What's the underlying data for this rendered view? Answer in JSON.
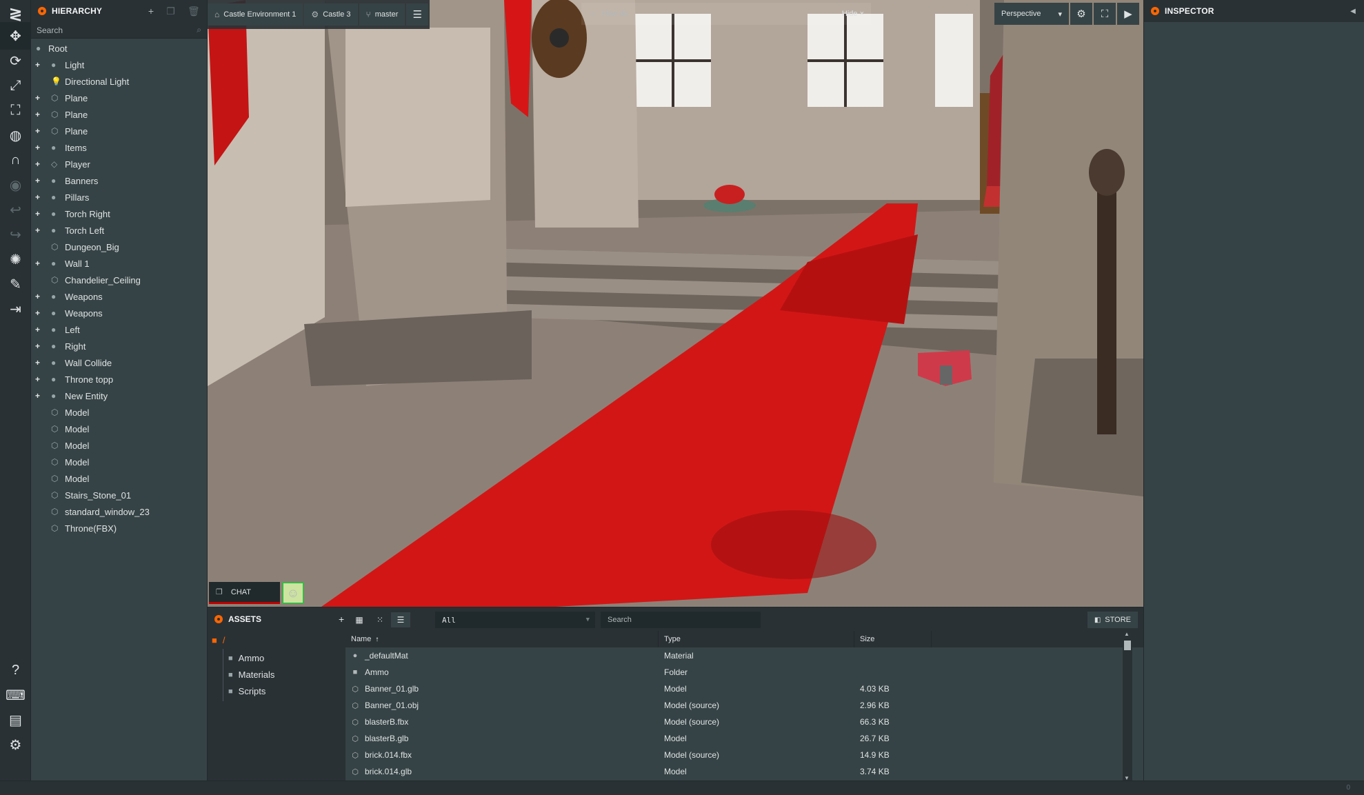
{
  "toolbar": {
    "items": [
      "logo-icon",
      "translate-icon",
      "rotate-icon",
      "scale-icon",
      "resize-icon",
      "world-icon",
      "snap-icon",
      "visibility-icon",
      "undo-icon",
      "redo-icon",
      "light-icon",
      "edit-icon",
      "publish-icon"
    ],
    "bottom": [
      "help-icon",
      "keyboard-icon",
      "feedback-icon",
      "settings-icon"
    ]
  },
  "hierarchy": {
    "title": "HIERARCHY",
    "search_placeholder": "Search",
    "root": "Root",
    "nodes": [
      {
        "label": "Light",
        "expandable": true,
        "icon": "entity-icon"
      },
      {
        "label": "Directional Light",
        "expandable": false,
        "icon": "light-bulb-icon"
      },
      {
        "label": "Plane",
        "expandable": true,
        "icon": "model-icon"
      },
      {
        "label": "Plane",
        "expandable": true,
        "icon": "model-icon"
      },
      {
        "label": "Plane",
        "expandable": true,
        "icon": "model-icon"
      },
      {
        "label": "Items",
        "expandable": true,
        "icon": "entity-icon"
      },
      {
        "label": "Player",
        "expandable": true,
        "icon": "script-icon"
      },
      {
        "label": "Banners",
        "expandable": true,
        "icon": "entity-icon"
      },
      {
        "label": "Pillars",
        "expandable": true,
        "icon": "entity-icon"
      },
      {
        "label": "Torch Right",
        "expandable": true,
        "icon": "entity-icon"
      },
      {
        "label": "Torch Left",
        "expandable": true,
        "icon": "entity-icon"
      },
      {
        "label": "Dungeon_Big",
        "expandable": false,
        "icon": "model-icon"
      },
      {
        "label": "Wall 1",
        "expandable": true,
        "icon": "entity-icon"
      },
      {
        "label": "Chandelier_Ceiling",
        "expandable": false,
        "icon": "model-icon"
      },
      {
        "label": "Weapons",
        "expandable": true,
        "icon": "entity-icon"
      },
      {
        "label": "Weapons",
        "expandable": true,
        "icon": "entity-icon"
      },
      {
        "label": "Left",
        "expandable": true,
        "icon": "entity-icon"
      },
      {
        "label": "Right",
        "expandable": true,
        "icon": "entity-icon"
      },
      {
        "label": "Wall Collide",
        "expandable": true,
        "icon": "entity-icon"
      },
      {
        "label": "Throne topp",
        "expandable": true,
        "icon": "entity-icon"
      },
      {
        "label": "New Entity",
        "expandable": true,
        "icon": "entity-icon"
      },
      {
        "label": "Model",
        "expandable": false,
        "icon": "model-icon"
      },
      {
        "label": "Model",
        "expandable": false,
        "icon": "model-icon"
      },
      {
        "label": "Model",
        "expandable": false,
        "icon": "model-icon"
      },
      {
        "label": "Model",
        "expandable": false,
        "icon": "model-icon"
      },
      {
        "label": "Model",
        "expandable": false,
        "icon": "model-icon"
      },
      {
        "label": "Stairs_Stone_01",
        "expandable": false,
        "icon": "model-icon"
      },
      {
        "label": "standard_window_23",
        "expandable": false,
        "icon": "model-icon"
      },
      {
        "label": "Throne(FBX)",
        "expandable": false,
        "icon": "model-icon"
      }
    ]
  },
  "viewport": {
    "project": "Castle Environment 1",
    "scene": "Castle 3",
    "branch": "master",
    "search_text": "How do",
    "hide_label": "Hide",
    "camera": "Perspective",
    "chat_label": "CHAT"
  },
  "assets": {
    "title": "ASSETS",
    "filter": "All",
    "search_placeholder": "Search",
    "store_label": "STORE",
    "root_folder": "/",
    "folders": [
      "Ammo",
      "Materials",
      "Scripts"
    ],
    "columns": {
      "name": "Name",
      "type": "Type",
      "size": "Size"
    },
    "rows": [
      {
        "name": "_defaultMat",
        "type": "Material",
        "size": "",
        "icon": "material-icon"
      },
      {
        "name": "Ammo",
        "type": "Folder",
        "size": "",
        "icon": "folder-icon"
      },
      {
        "name": "Banner_01.glb",
        "type": "Model",
        "size": "4.03 KB",
        "icon": "model-icon"
      },
      {
        "name": "Banner_01.obj",
        "type": "Model (source)",
        "size": "2.96 KB",
        "icon": "model-icon"
      },
      {
        "name": "blasterB.fbx",
        "type": "Model (source)",
        "size": "66.3 KB",
        "icon": "model-icon"
      },
      {
        "name": "blasterB.glb",
        "type": "Model",
        "size": "26.7 KB",
        "icon": "model-icon"
      },
      {
        "name": "brick.014.fbx",
        "type": "Model (source)",
        "size": "14.9 KB",
        "icon": "model-icon"
      },
      {
        "name": "brick.014.glb",
        "type": "Model",
        "size": "3.74 KB",
        "icon": "model-icon"
      }
    ]
  },
  "inspector": {
    "title": "INSPECTOR"
  },
  "statusbar": {
    "text": "0"
  },
  "colors": {
    "accent": "#ff6600",
    "carpet": "#d21616",
    "panel": "#364346",
    "dark": "#2a3135"
  }
}
